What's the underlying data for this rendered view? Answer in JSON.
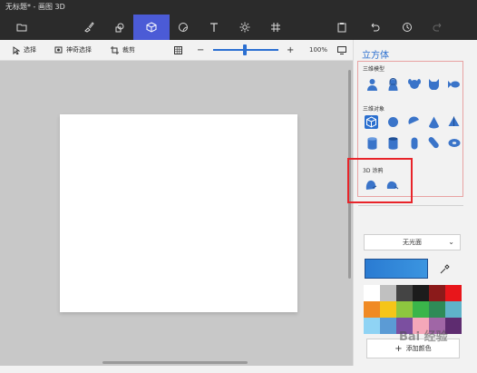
{
  "window": {
    "title": "无标题* - 画图 3D"
  },
  "toolbar": {
    "items": [
      "menu",
      "brushes",
      "2d-shapes",
      "3d-shapes",
      "stickers",
      "text",
      "effects",
      "canvas",
      "paste",
      "undo",
      "history",
      "redo"
    ]
  },
  "subbar": {
    "select": "选择",
    "magic_select": "神奇选择",
    "crop": "裁剪",
    "zoom": "100%",
    "minus": "−",
    "plus": "+"
  },
  "panel": {
    "title": "立方体",
    "models_label": "三维模型",
    "objects_label": "三维对象",
    "doodle_label": "3D 涂鸦",
    "material": "无光面",
    "add_color": "添加颜色",
    "selected_color": "#2a7bd2",
    "palette": [
      "#ffffff",
      "#c0c0c0",
      "#444444",
      "#1c1c1c",
      "#8b1a1a",
      "#e8161b",
      "#f08a24",
      "#f5c518",
      "#8dc63f",
      "#3ab54a",
      "#2e8b57",
      "#5fb3c9",
      "#8fd3f4",
      "#5b9bd5",
      "#7b4fa0",
      "#f4a7b9",
      "#a066a6",
      "#5e2c70"
    ]
  },
  "watermark": "Bai 经验"
}
